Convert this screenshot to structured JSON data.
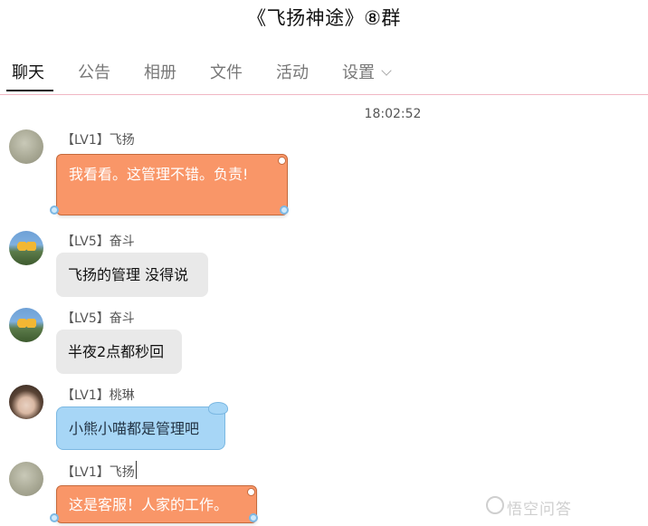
{
  "header": {
    "title": "《飞扬神途》⑧群"
  },
  "tabs": [
    {
      "label": "聊天",
      "active": true
    },
    {
      "label": "公告",
      "active": false
    },
    {
      "label": "相册",
      "active": false
    },
    {
      "label": "文件",
      "active": false
    },
    {
      "label": "活动",
      "active": false
    },
    {
      "label": "设置",
      "active": false
    }
  ],
  "chat": {
    "timestamp": "18:02:52",
    "messages": [
      {
        "sender": "【LV1】飞扬",
        "text": "我看看。这管理不错。负责!",
        "style": "orange",
        "avatar": "gray-avatar"
      },
      {
        "sender": "【LV5】奋斗",
        "text": "飞扬的管理 没得说",
        "style": "gray",
        "avatar": "landscape-avatar"
      },
      {
        "sender": "【LV5】奋斗",
        "text": "半夜2点都秒回",
        "style": "gray",
        "avatar": "landscape-avatar"
      },
      {
        "sender": "【LV1】桃琳",
        "text": "小熊小喵都是管理吧",
        "style": "blue",
        "avatar": "face-avatar"
      },
      {
        "sender": "【LV1】飞扬",
        "text": "这是客服！人家的工作。",
        "style": "orange",
        "avatar": "gray-avatar"
      }
    ]
  },
  "watermark": {
    "text": "悟空问答"
  },
  "colors": {
    "orange_bubble": "#f99668",
    "gray_bubble": "#e9e9e9",
    "blue_bubble": "#a7d6f6",
    "tab_divider": "#f0b7c4"
  }
}
